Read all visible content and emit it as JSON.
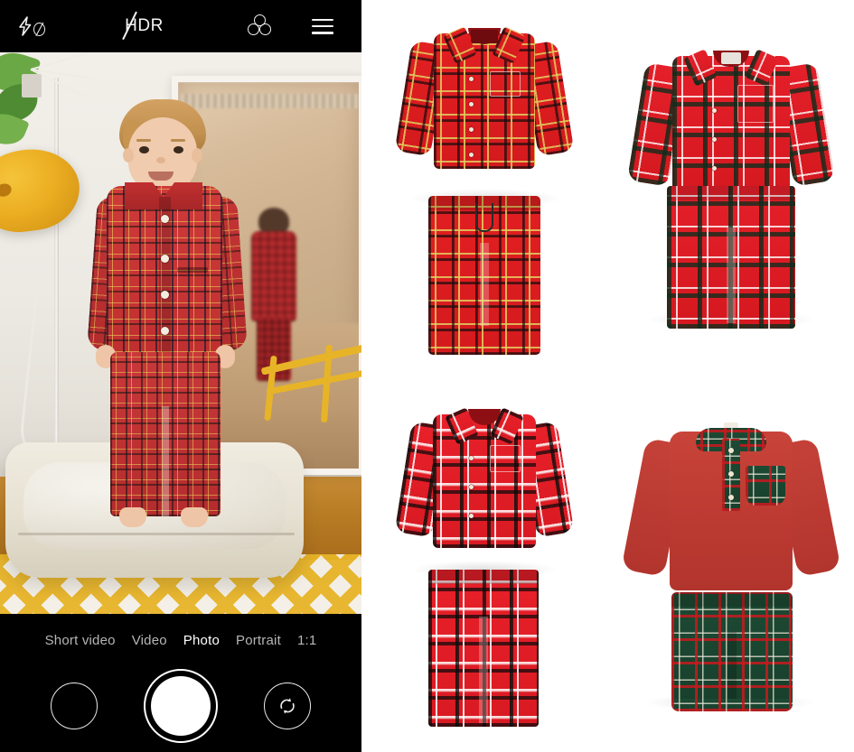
{
  "app": {
    "name": "Camera",
    "screen": "camera-viewfinder"
  },
  "top_bar": {
    "flash": {
      "icon": "flash-off-icon",
      "label": "Flash off",
      "state": "off"
    },
    "hdr": {
      "icon": "hdr-off-icon",
      "label": "HDR",
      "state": "off"
    },
    "filters": {
      "icon": "color-filters-icon",
      "label": "Filters"
    },
    "menu": {
      "icon": "hamburger-menu-icon",
      "label": "More settings"
    }
  },
  "viewfinder": {
    "description": "Live preview of a young boy standing on a mattress wearing red tartan plaid pyjamas",
    "subject": "child in red tartan pyjamas",
    "props": [
      "yellow dome lamp",
      "mirror",
      "yellow metal rail",
      "yellow chevron rug",
      "green plant"
    ]
  },
  "modes": [
    {
      "label": "Short video",
      "active": false
    },
    {
      "label": "Video",
      "active": false
    },
    {
      "label": "Photo",
      "active": true
    },
    {
      "label": "Portrait",
      "active": false
    },
    {
      "label": "1:1",
      "active": false
    }
  ],
  "controls": {
    "gallery": {
      "icon": "gallery-thumbnail-icon",
      "label": "Gallery"
    },
    "shutter": {
      "icon": "shutter-button-icon",
      "label": "Take photo"
    },
    "flip": {
      "icon": "camera-flip-icon",
      "label": "Switch camera"
    }
  },
  "products": [
    {
      "id": "product-1",
      "name": "Red tartan flannel pyjama set",
      "pieces": [
        "button-up shirt",
        "drawstring trousers"
      ],
      "pattern": "red tartan",
      "colors": {
        "base": "#e21f22",
        "accent": "#e1cd5f",
        "dark": "#141414"
      }
    },
    {
      "id": "product-2",
      "name": "Red and green tartan pyjama set",
      "pieces": [
        "button-up shirt with chest pocket",
        "trousers"
      ],
      "pattern": "red green tartan",
      "colors": {
        "base": "#e4202a",
        "accent": "#ffffff",
        "dark": "#0c2d1c"
      }
    },
    {
      "id": "product-3",
      "name": "Red black and white tartan pyjama set",
      "pieces": [
        "button-up shirt with chest pocket",
        "trousers"
      ],
      "pattern": "red black white tartan",
      "colors": {
        "base": "#e8202a",
        "accent": "#ffffff",
        "dark": "#0a0a0a"
      }
    },
    {
      "id": "product-4",
      "name": "Red henley top with green tartan trousers",
      "pieces": [
        "henley long sleeve top",
        "cuffed trousers"
      ],
      "pattern": "solid red top, green tartan bottoms",
      "colors": {
        "base": "#c23b32",
        "accent": "#1d4a34",
        "dark": "#c8191e"
      }
    }
  ],
  "theme": {
    "app_background": "#000000",
    "panel_background": "#ffffff",
    "text_active": "#ffffff",
    "text_inactive": "#b6b6b6"
  }
}
